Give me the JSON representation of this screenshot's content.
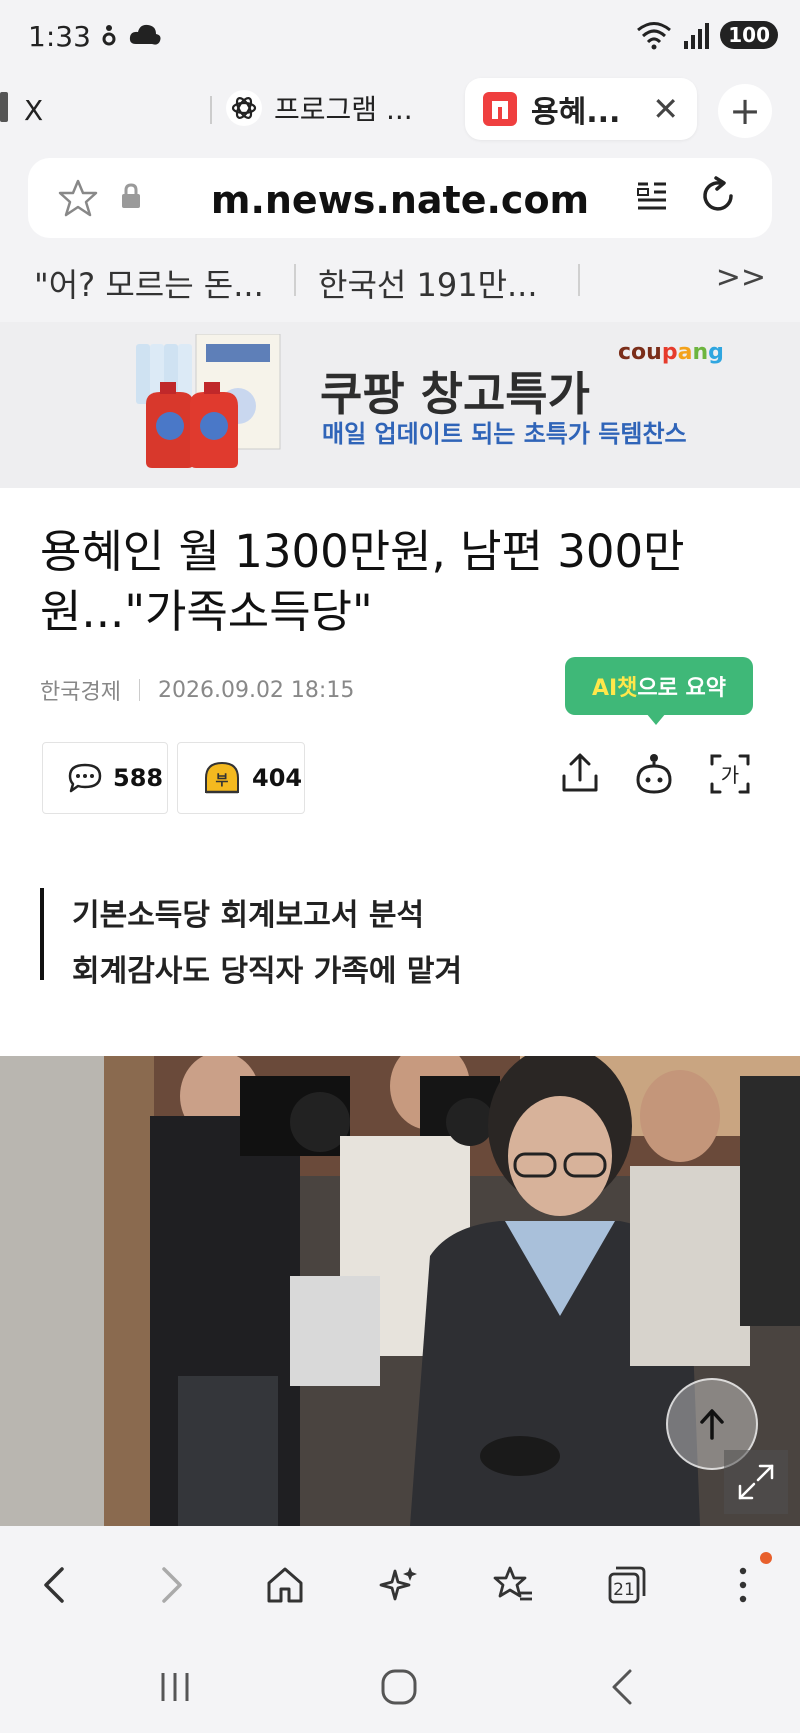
{
  "status": {
    "time": "1:33",
    "battery": "100"
  },
  "tabs": [
    {
      "label": "X",
      "favicon": "x-icon"
    },
    {
      "label": "프로그램 ...",
      "favicon": "chatgpt-icon"
    },
    {
      "label": "용혜...",
      "favicon": "nate-icon",
      "active": true
    }
  ],
  "url": {
    "host": "m.news.nate.com"
  },
  "quick_links": [
    "\"어? 모르는 돈...",
    "한국선 191만..."
  ],
  "ad": {
    "title": "쿠팡 창고특가",
    "subtitle": "매일 업데이트 되는 초특가 득템찬스",
    "brand": "coupang"
  },
  "article": {
    "headline": "용혜인 월 1300만원, 남편 300만원...\"가족소득당\"",
    "source": "한국경제",
    "datetime": "2026.09.02 18:15",
    "ai_summary_label_highlight": "AI챗",
    "ai_summary_label_rest": "으로 요약",
    "comments": "588",
    "reactions": "404",
    "summary_lines": [
      "기본소득당 회계보고서 분석",
      "회계감사도 당직자 가족에 맡겨"
    ]
  },
  "toolbar": {
    "tab_count": "21"
  },
  "colors": {
    "accent_green": "#3fb878",
    "nate_red": "#ef3f3f",
    "ad_blue": "#2f64b8"
  }
}
